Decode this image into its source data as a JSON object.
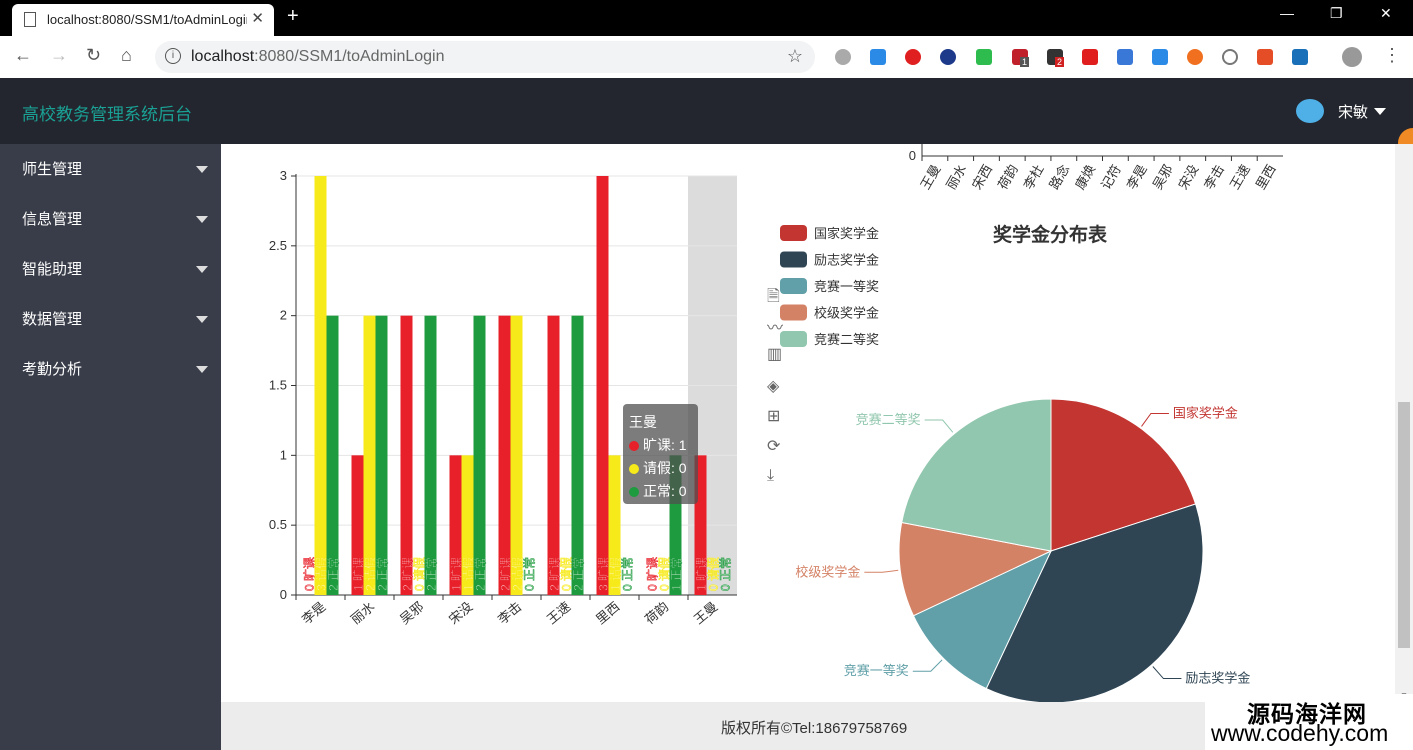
{
  "browser": {
    "tab_title": "localhost:8080/SSM1/toAdminLogin",
    "tab_close": "✕",
    "new_tab": "+",
    "url_host": "localhost",
    "url_rest": ":8080/SSM1/toAdminLogin",
    "minimize": "—",
    "restore": "❐",
    "close": "✕",
    "back": "←",
    "forward": "→",
    "reload": "↻",
    "home": "⌂",
    "star": "☆",
    "menu": "⋮",
    "ext_badge_1": "1",
    "ext_badge_2": "2"
  },
  "header": {
    "brand": "高校教务管理系统后台",
    "user_name": "宋敏"
  },
  "sidebar": {
    "items": [
      {
        "label": "师生管理"
      },
      {
        "label": "信息管理"
      },
      {
        "label": "智能助理"
      },
      {
        "label": "数据管理"
      },
      {
        "label": "考勤分析"
      }
    ]
  },
  "footer": {
    "copyright": "版权所有©Tel:18679758769"
  },
  "watermark": {
    "line1": "源码海洋网",
    "line2": "www.codehy.com"
  },
  "tooltip": {
    "title": "王曼",
    "rows": [
      {
        "label": "旷课: 1",
        "color": "#e8202a"
      },
      {
        "label": "请假: 0",
        "color": "#f7ea1a"
      },
      {
        "label": "正常: 0",
        "color": "#1e9b3e"
      }
    ]
  },
  "chart_data": [
    {
      "type": "bar",
      "categories": [
        "李是",
        "丽水",
        "吴邪",
        "宋没",
        "李击",
        "王速",
        "里西",
        "荷韵",
        "王曼"
      ],
      "series": [
        {
          "name": "旷课",
          "color": "#e8202a",
          "values": [
            0,
            1,
            2,
            1,
            2,
            2,
            3,
            0,
            1
          ]
        },
        {
          "name": "请假",
          "color": "#f7ea1a",
          "values": [
            3,
            2,
            0,
            1,
            2,
            0,
            1,
            0,
            0
          ]
        },
        {
          "name": "正常",
          "color": "#1e9b3e",
          "values": [
            2,
            2,
            2,
            2,
            0,
            2,
            0,
            1,
            0
          ]
        }
      ],
      "yticks": [
        "0",
        "0.5",
        "1",
        "1.5",
        "2",
        "2.5",
        "3"
      ],
      "ylim": [
        0,
        3
      ],
      "highlighted_category": "王曼"
    },
    {
      "type": "bar",
      "partial": true,
      "categories": [
        "王曼",
        "丽水",
        "宋西",
        "荷韵",
        "李杜",
        "路念",
        "康焕",
        "记符",
        "李是",
        "吴邪",
        "宋没",
        "李击",
        "王速",
        "里西"
      ],
      "yticks": [
        "0"
      ]
    },
    {
      "type": "pie",
      "title": "奖学金分布表",
      "slices": [
        {
          "label": "国家奖学金",
          "value": 20,
          "color": "#c23531"
        },
        {
          "label": "励志奖学金",
          "value": 37,
          "color": "#2f4554"
        },
        {
          "label": "竞赛一等奖",
          "value": 11,
          "color": "#61a0a8"
        },
        {
          "label": "校级奖学金",
          "value": 10,
          "color": "#d48265"
        },
        {
          "label": "竞赛二等奖",
          "value": 22,
          "color": "#91c7ae"
        }
      ]
    }
  ],
  "toolbox_icons": [
    "data-view-icon",
    "line-icon",
    "bar-icon",
    "stack-icon",
    "tiled-icon",
    "restore-icon",
    "save-image-icon"
  ],
  "extension_icons": [
    "weibo-icon",
    "download-icon",
    "opera-icon",
    "vivaldi-icon",
    "shield-icon",
    "ext-red-icon",
    "ext-dark-icon",
    "youtube-icon",
    "ext-blue-icon",
    "edit-icon",
    "ext-orange-icon",
    "infinity-icon",
    "html5-icon",
    "ext-teal-icon",
    "account-icon"
  ]
}
